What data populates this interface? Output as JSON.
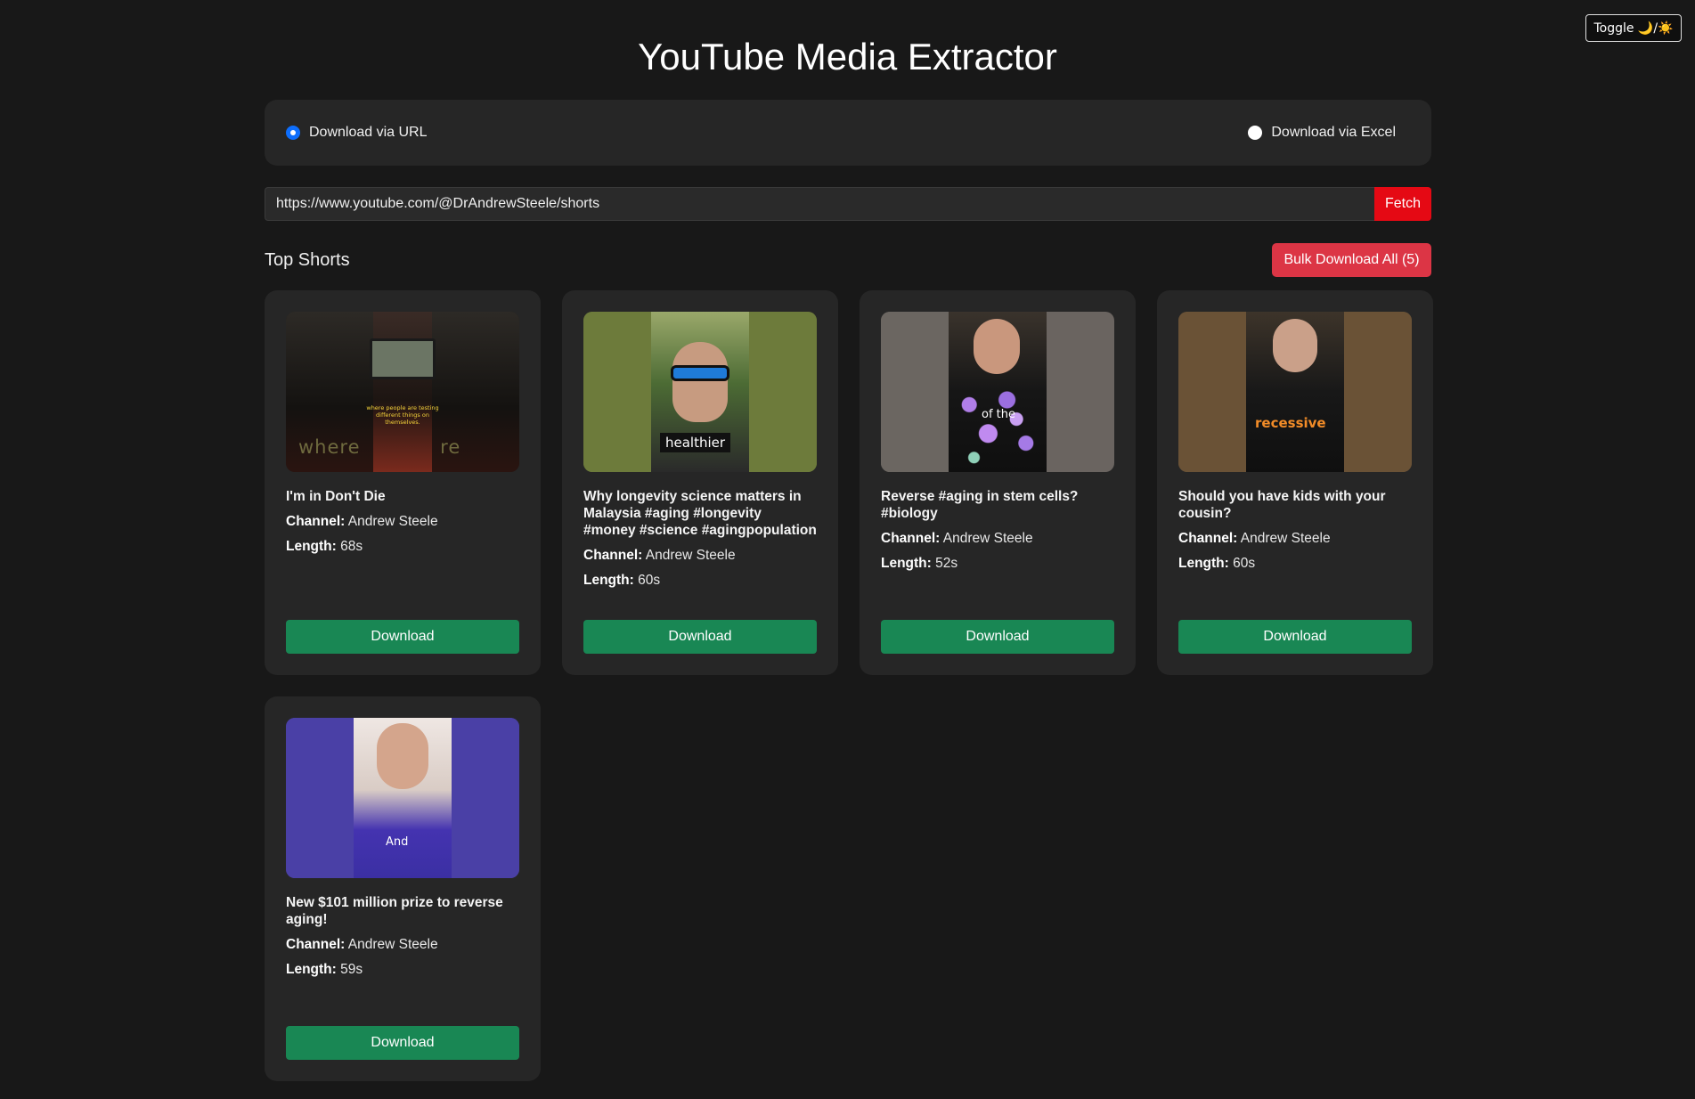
{
  "header": {
    "title": "YouTube Media Extractor",
    "toggle_label": "Toggle 🌙/☀️"
  },
  "mode": {
    "options": [
      {
        "label": "Download via URL",
        "selected": true
      },
      {
        "label": "Download via Excel",
        "selected": false
      }
    ]
  },
  "url_form": {
    "value": "https://www.youtube.com/@DrAndrewSteele/shorts",
    "fetch_label": "Fetch"
  },
  "results": {
    "section_title": "Top Shorts",
    "bulk_label": "Bulk Download All (5)",
    "channel_label": "Channel:",
    "length_label": "Length:",
    "download_label": "Download",
    "items": [
      {
        "title": "I'm in Don't Die",
        "channel": "Andrew Steele",
        "length": "68s",
        "thumb_caption": "where people are testing different things on themselves.",
        "thumb_overlay": "where re"
      },
      {
        "title": "Why longevity science matters in Malaysia #aging #longevity #money #science #agingpopulation",
        "channel": "Andrew Steele",
        "length": "60s",
        "thumb_caption": "healthier"
      },
      {
        "title": "Reverse #aging in stem cells? #biology",
        "channel": "Andrew Steele",
        "length": "52s",
        "thumb_caption": "of the"
      },
      {
        "title": "Should you have kids with your cousin?",
        "channel": "Andrew Steele",
        "length": "60s",
        "thumb_caption": "recessive"
      },
      {
        "title": "New $101 million prize to reverse aging!",
        "channel": "Andrew Steele",
        "length": "59s",
        "thumb_caption": "And"
      }
    ]
  },
  "colors": {
    "accent_blue": "#0d6efd",
    "fetch_red": "#e50914",
    "bulk_red": "#dc3545",
    "download_green": "#198754"
  }
}
